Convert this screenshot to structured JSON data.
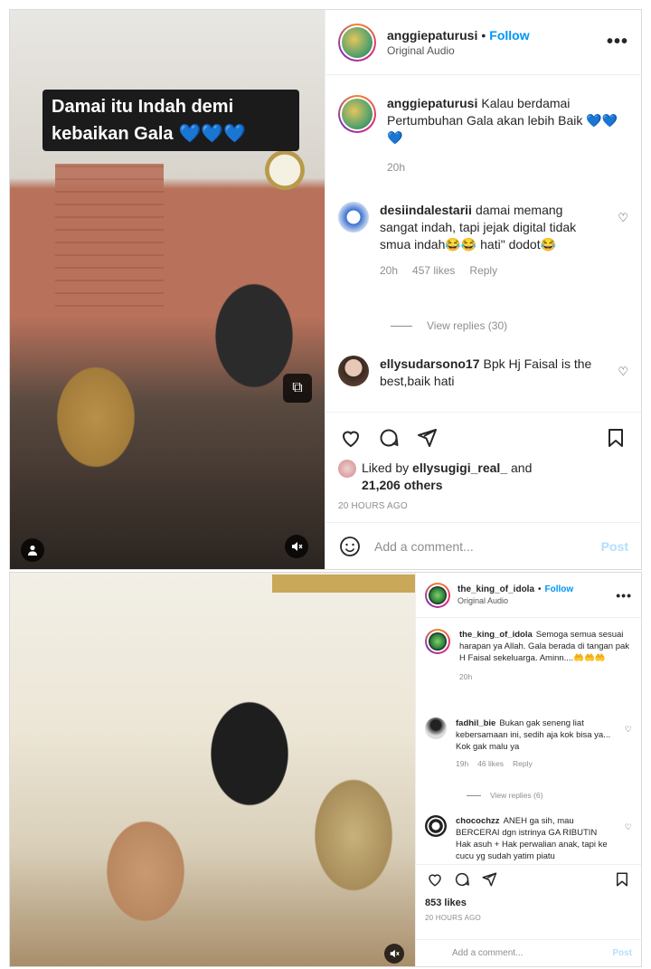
{
  "top_post": {
    "media": {
      "caption_line1": "Damai itu Indah demi",
      "caption_line2": "kebaikan Gala",
      "caption_hearts": "💙💙💙"
    },
    "header": {
      "username": "anggiepaturusi",
      "separator": "•",
      "follow_label": "Follow",
      "subtitle": "Original Audio",
      "more_label": "•••"
    },
    "comments": [
      {
        "username": "anggiepaturusi",
        "text": "Kalau berdamai Pertumbuhan Gala akan lebih Baik 💙💙💙",
        "time": "20h"
      },
      {
        "username": "desiindalestarii",
        "text": "damai memang sangat indah, tapi jejak digital tidak smua indah😂😂 hati\" dodot😂",
        "time": "20h",
        "likes": "457 likes",
        "reply_label": "Reply",
        "view_replies": "View replies (30)"
      },
      {
        "username": "ellysudarsono17",
        "text": "Bpk Hj Faisal is the best,baik hati"
      }
    ],
    "liked_by_prefix": "Liked by",
    "liked_by_user": "ellysugigi_real_",
    "liked_by_and": "and",
    "liked_by_others": "21,206 others",
    "timestamp": "20 HOURS AGO",
    "add_comment_placeholder": "Add a comment...",
    "post_label": "Post"
  },
  "bottom_post": {
    "header": {
      "username": "the_king_of_idola",
      "separator": "•",
      "follow_label": "Follow",
      "subtitle": "Original Audio",
      "more_label": "•••"
    },
    "comments": [
      {
        "username": "the_king_of_idola",
        "text": "Semoga semua sesuai harapan ya Allah. Gala berada di tangan pak H Faisal sekeluarga. Aminn....🤲🤲🤲",
        "time": "20h"
      },
      {
        "username": "fadhil_bie",
        "text": "Bukan gak seneng liat kebersamaan ini, sedih aja kok bisa ya... Kok gak malu ya",
        "time": "19h",
        "likes": "46 likes",
        "reply_label": "Reply",
        "view_replies": "View replies (6)"
      },
      {
        "username": "chocochzz",
        "text": "ANEH ga sih, mau BERCERAI dgn istrinya GA RIBUTIN Hak asuh + Hak perwalian anak, tapi ke cucu yg sudah yatim piatu"
      }
    ],
    "likes_count": "853 likes",
    "timestamp": "20 HOURS AGO",
    "add_comment_placeholder": "Add a comment...",
    "post_label": "Post"
  },
  "colors": {
    "follow_blue": "#0095f6",
    "post_disabled": "#b2dffc",
    "muted_text": "#8e8e8e",
    "heart_blue": "#2f7df6"
  },
  "icons": [
    "heart-icon",
    "comment-icon",
    "share-icon",
    "bookmark-icon",
    "emoji-icon",
    "user-tag-icon",
    "mute-icon",
    "picture-in-picture-icon",
    "more-options-icon"
  ]
}
